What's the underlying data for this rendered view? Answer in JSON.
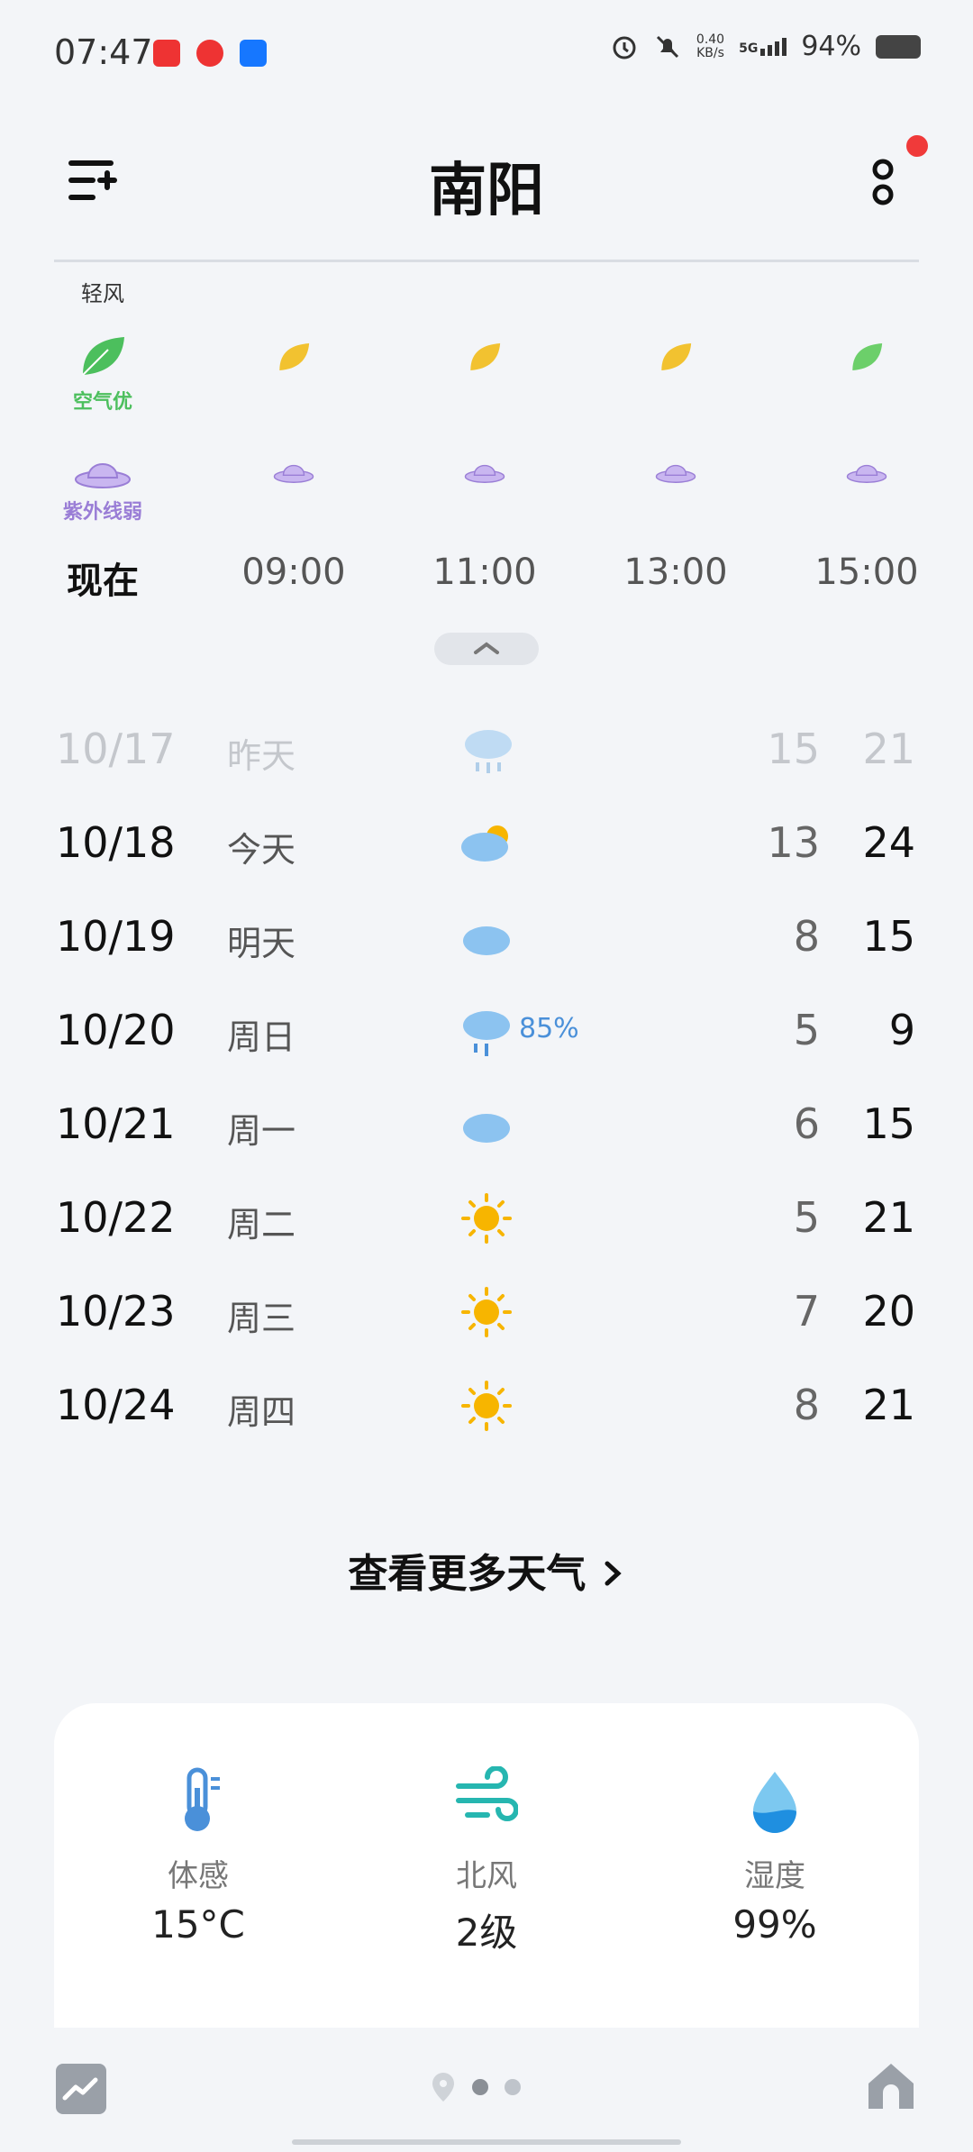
{
  "status_bar": {
    "time": "07:47",
    "net_speed": "0.40",
    "net_unit": "KB/s",
    "signal": "5G",
    "battery": "94%"
  },
  "header": {
    "city": "南阳"
  },
  "hourly": {
    "wind_label": "轻风",
    "air_quality_label": "空气优",
    "uv_label": "紫外线弱",
    "hours": [
      "现在",
      "09:00",
      "11:00",
      "13:00",
      "15:00"
    ]
  },
  "daily": [
    {
      "date": "10/17",
      "day": "昨天",
      "icon": "rain-cloud-icon",
      "pop": "",
      "low": "15",
      "high": "21"
    },
    {
      "date": "10/18",
      "day": "今天",
      "icon": "partly-cloudy-icon",
      "pop": "",
      "low": "13",
      "high": "24"
    },
    {
      "date": "10/19",
      "day": "明天",
      "icon": "cloud-icon",
      "pop": "",
      "low": "8",
      "high": "15"
    },
    {
      "date": "10/20",
      "day": "周日",
      "icon": "rain-cloud-icon",
      "pop": "85%",
      "low": "5",
      "high": "9"
    },
    {
      "date": "10/21",
      "day": "周一",
      "icon": "cloud-icon",
      "pop": "",
      "low": "6",
      "high": "15"
    },
    {
      "date": "10/22",
      "day": "周二",
      "icon": "sun-icon",
      "pop": "",
      "low": "5",
      "high": "21"
    },
    {
      "date": "10/23",
      "day": "周三",
      "icon": "sun-icon",
      "pop": "",
      "low": "7",
      "high": "20"
    },
    {
      "date": "10/24",
      "day": "周四",
      "icon": "sun-icon",
      "pop": "",
      "low": "8",
      "high": "21"
    }
  ],
  "more_weather": "查看更多天气",
  "details": {
    "feels_like_label": "体感",
    "feels_like_value": "15°C",
    "wind_label": "北风",
    "wind_value": "2级",
    "humidity_label": "湿度",
    "humidity_value": "99%"
  },
  "colors": {
    "background": "#f3f5f8",
    "leaf_good": "#4cbf5d",
    "leaf_yellow": "#f2c230",
    "uv_purple": "#9a7ed6",
    "accent_blue": "#4a90d9",
    "sun": "#f7b500",
    "notification": "#f03a3a"
  }
}
